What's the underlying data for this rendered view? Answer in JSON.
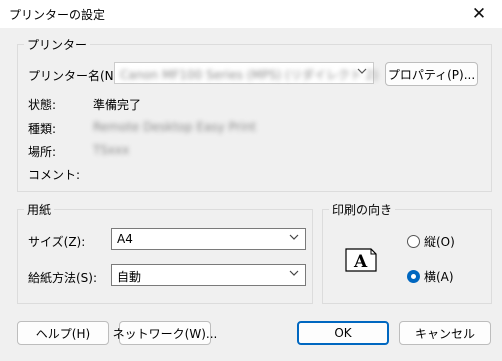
{
  "window": {
    "title": "プリンターの設定",
    "close_glyph": "✕"
  },
  "printer": {
    "group_title": "プリンター",
    "name_label": "プリンター名(N):",
    "name_value": "Canon MF100 Series (MPS) (リダイレクト 2)",
    "properties_button": "プロパティ(P)...",
    "status_label": "状態:",
    "status_value": "準備完了",
    "type_label": "種類:",
    "type_value": "Remote Desktop Easy Print",
    "where_label": "場所:",
    "where_value": "TSxxx",
    "comment_label": "コメント:",
    "comment_value": ""
  },
  "paper": {
    "group_title": "用紙",
    "size_label": "サイズ(Z):",
    "size_value": "A4",
    "source_label": "給紙方法(S):",
    "source_value": "自動"
  },
  "orientation": {
    "group_title": "印刷の向き",
    "icon_letter": "A",
    "portrait_label": "縦(O)",
    "landscape_label": "横(A)",
    "selected": "landscape"
  },
  "buttons": {
    "help": "ヘルプ(H)",
    "network": "ネットワーク(W)...",
    "ok": "OK",
    "cancel": "キャンセル"
  }
}
